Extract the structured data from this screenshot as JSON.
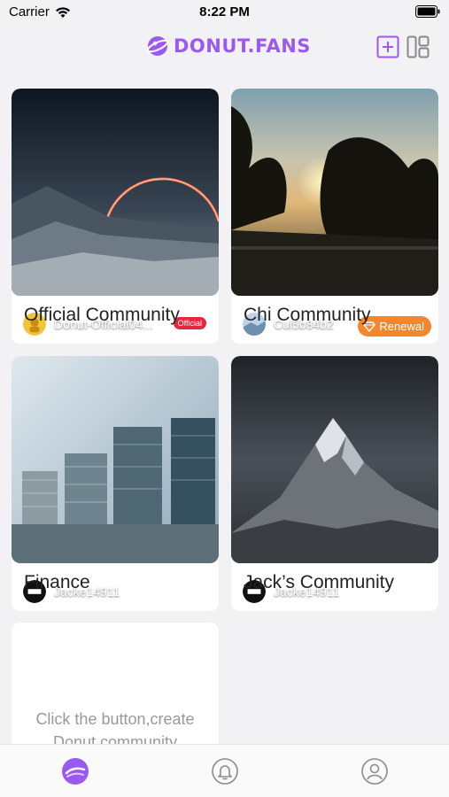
{
  "status_bar": {
    "carrier": "Carrier",
    "time": "8:22 PM"
  },
  "header": {
    "brand": "DONUT.FANS",
    "accent_color": "#9b59f0"
  },
  "communities": [
    {
      "title": "Official Community",
      "owner": "Donut-Official04...",
      "badge": "Official"
    },
    {
      "title": "Chi Community",
      "owner": "Cui5b84b2",
      "badge": "Renewal"
    },
    {
      "title": "Finance",
      "owner": "Jacke14911"
    },
    {
      "title": "Jack’s Community",
      "owner": "Jacke14911"
    }
  ],
  "create_card": {
    "line1": "Click the button,create",
    "line2": "Donut community"
  },
  "tabbar": {
    "items": [
      "home-icon",
      "bell-icon",
      "profile-icon"
    ],
    "active_index": 0
  }
}
